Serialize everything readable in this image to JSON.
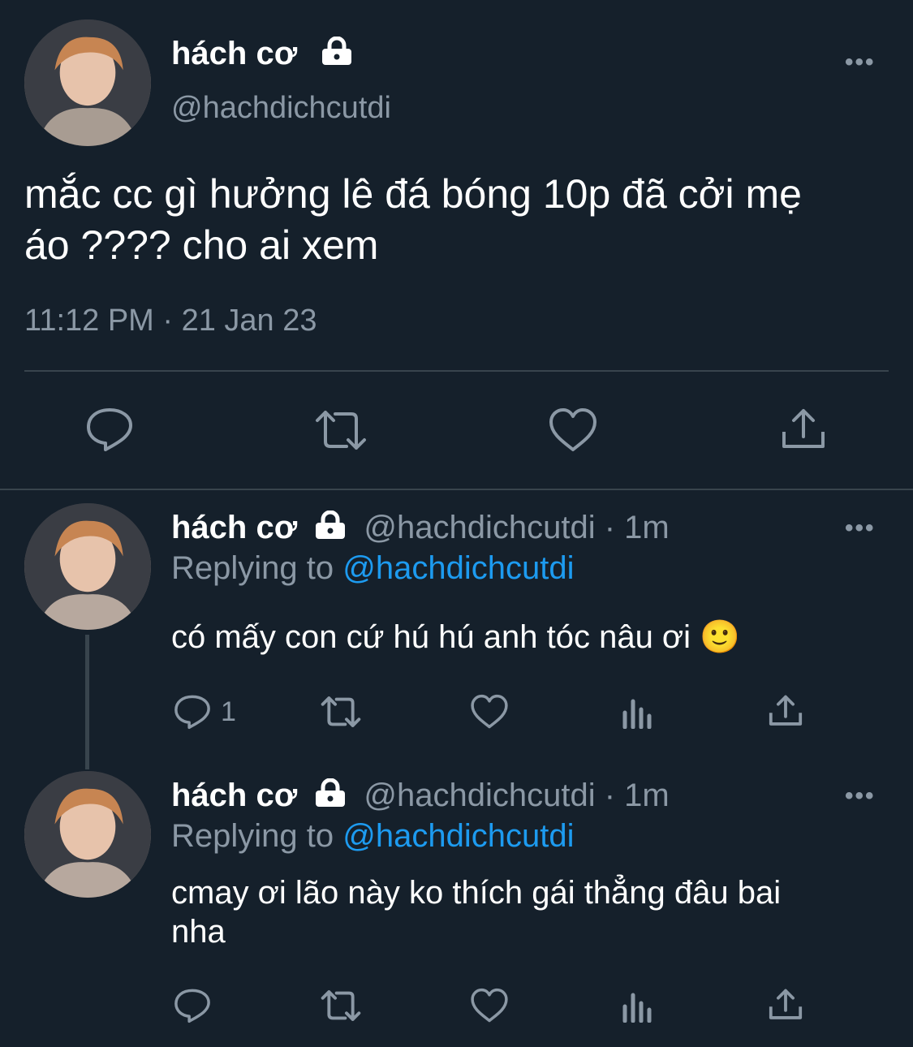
{
  "main_tweet": {
    "display_name": "hách cơ",
    "handle": "@hachdichcutdi",
    "text_line1": "mắc cc gì hưởng lê đá bóng 10p đã cởi mẹ",
    "text_line2": "áo ???? cho ai xem",
    "timestamp": "11:12 PM · 21 Jan 23"
  },
  "replies": [
    {
      "display_name": "hách cơ",
      "handle": "@hachdichcutdi",
      "time": "· 1m",
      "replying_prefix": "Replying to",
      "replying_handle": "@hachdichcutdi",
      "text_line1": "có mấy con cứ hú hú anh tóc nâu ơi 🙂",
      "text_line2": "",
      "reply_count": "1"
    },
    {
      "display_name": "hách cơ",
      "handle": "@hachdichcutdi",
      "time": "· 1m",
      "replying_prefix": "Replying to",
      "replying_handle": "@hachdichcutdi",
      "text_line1": "cmay ơi lão này ko thích gái thẳng đâu bai",
      "text_line2": "nha",
      "reply_count": ""
    }
  ],
  "more_label": "•••",
  "icons": [
    "comment-icon",
    "retweet-icon",
    "like-icon",
    "share-icon",
    "analytics-icon",
    "lock-icon",
    "more-icon"
  ],
  "colors": {
    "background": "#15202b",
    "muted": "#8b98a5",
    "link": "#1d9bf0",
    "divider": "#38444d"
  }
}
